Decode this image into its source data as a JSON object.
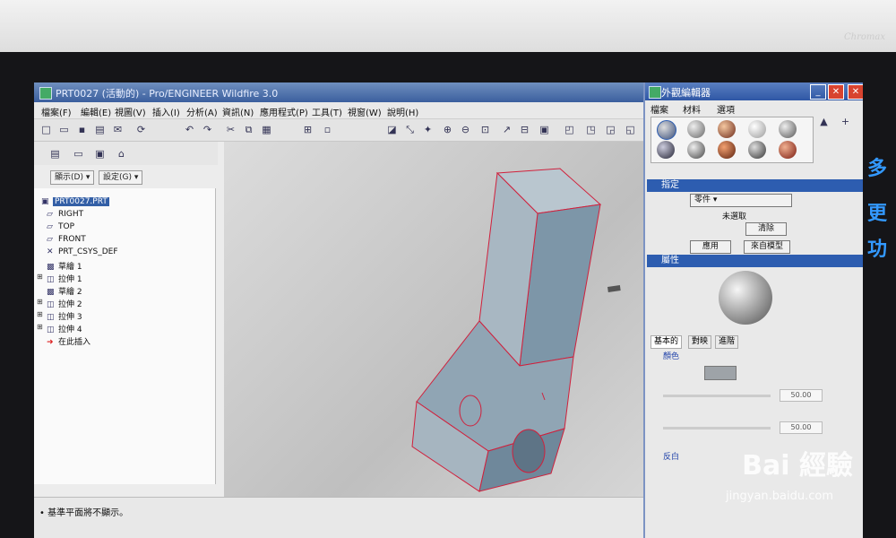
{
  "app": {
    "title": "PRT0027 (活動的) - Pro/ENGINEER Wildfire 3.0",
    "brand": "Chromax"
  },
  "menubar": {
    "items": [
      "檔案(F)",
      "編輯(E)",
      "視圖(V)",
      "插入(I)",
      "分析(A)",
      "資訊(N)",
      "應用程式(P)",
      "工具(T)",
      "視窗(W)",
      "說明(H)"
    ]
  },
  "left_panel": {
    "show_dropdown": "顯示(D) ▾",
    "settings_dropdown": "設定(G) ▾",
    "tree": [
      {
        "label": "PRT0027.PRT",
        "icon": "part-icon",
        "expandable": false,
        "root": true
      },
      {
        "label": "RIGHT",
        "icon": "datum-plane-icon",
        "expandable": false
      },
      {
        "label": "TOP",
        "icon": "datum-plane-icon",
        "expandable": false
      },
      {
        "label": "FRONT",
        "icon": "datum-plane-icon",
        "expandable": false
      },
      {
        "label": "PRT_CSYS_DEF",
        "icon": "csys-icon",
        "expandable": false
      },
      {
        "label": "草繪 1",
        "icon": "sketch-icon",
        "expandable": false
      },
      {
        "label": "拉伸 1",
        "icon": "extrude-icon",
        "expandable": true
      },
      {
        "label": "草繪 2",
        "icon": "sketch-icon",
        "expandable": false
      },
      {
        "label": "拉伸 2",
        "icon": "extrude-icon",
        "expandable": true
      },
      {
        "label": "拉伸 3",
        "icon": "extrude-icon",
        "expandable": true
      },
      {
        "label": "拉伸 4",
        "icon": "extrude-icon",
        "expandable": true
      },
      {
        "label": "在此插入",
        "icon": "insert-here-icon",
        "expandable": false
      }
    ]
  },
  "status": {
    "message": "• 基準平面將不顯示。"
  },
  "appearance_editor": {
    "title": "外觀編輯器",
    "menu": [
      "檔案",
      "材料",
      "選項"
    ],
    "assign_section": "指定",
    "assign_dropdown": "零件",
    "unselected_label": "未選取",
    "clear_button": "清除",
    "apply_button": "應用",
    "from_model_button": "來自模型",
    "properties_section": "屬性",
    "tabs": [
      "基本的",
      "對映",
      "進階"
    ],
    "color_label": "顏色",
    "reflection_label": "反白",
    "field_values": [
      "50.00",
      "50.00"
    ]
  },
  "watermark": {
    "main": "Bai 經驗",
    "sub": "jingyan.baidu.com"
  },
  "colors": {
    "titlebar": "#3b5f9e",
    "section_header": "#2d5db0",
    "model_edge": "#d0203c",
    "model_face": "#8aa2b4"
  }
}
